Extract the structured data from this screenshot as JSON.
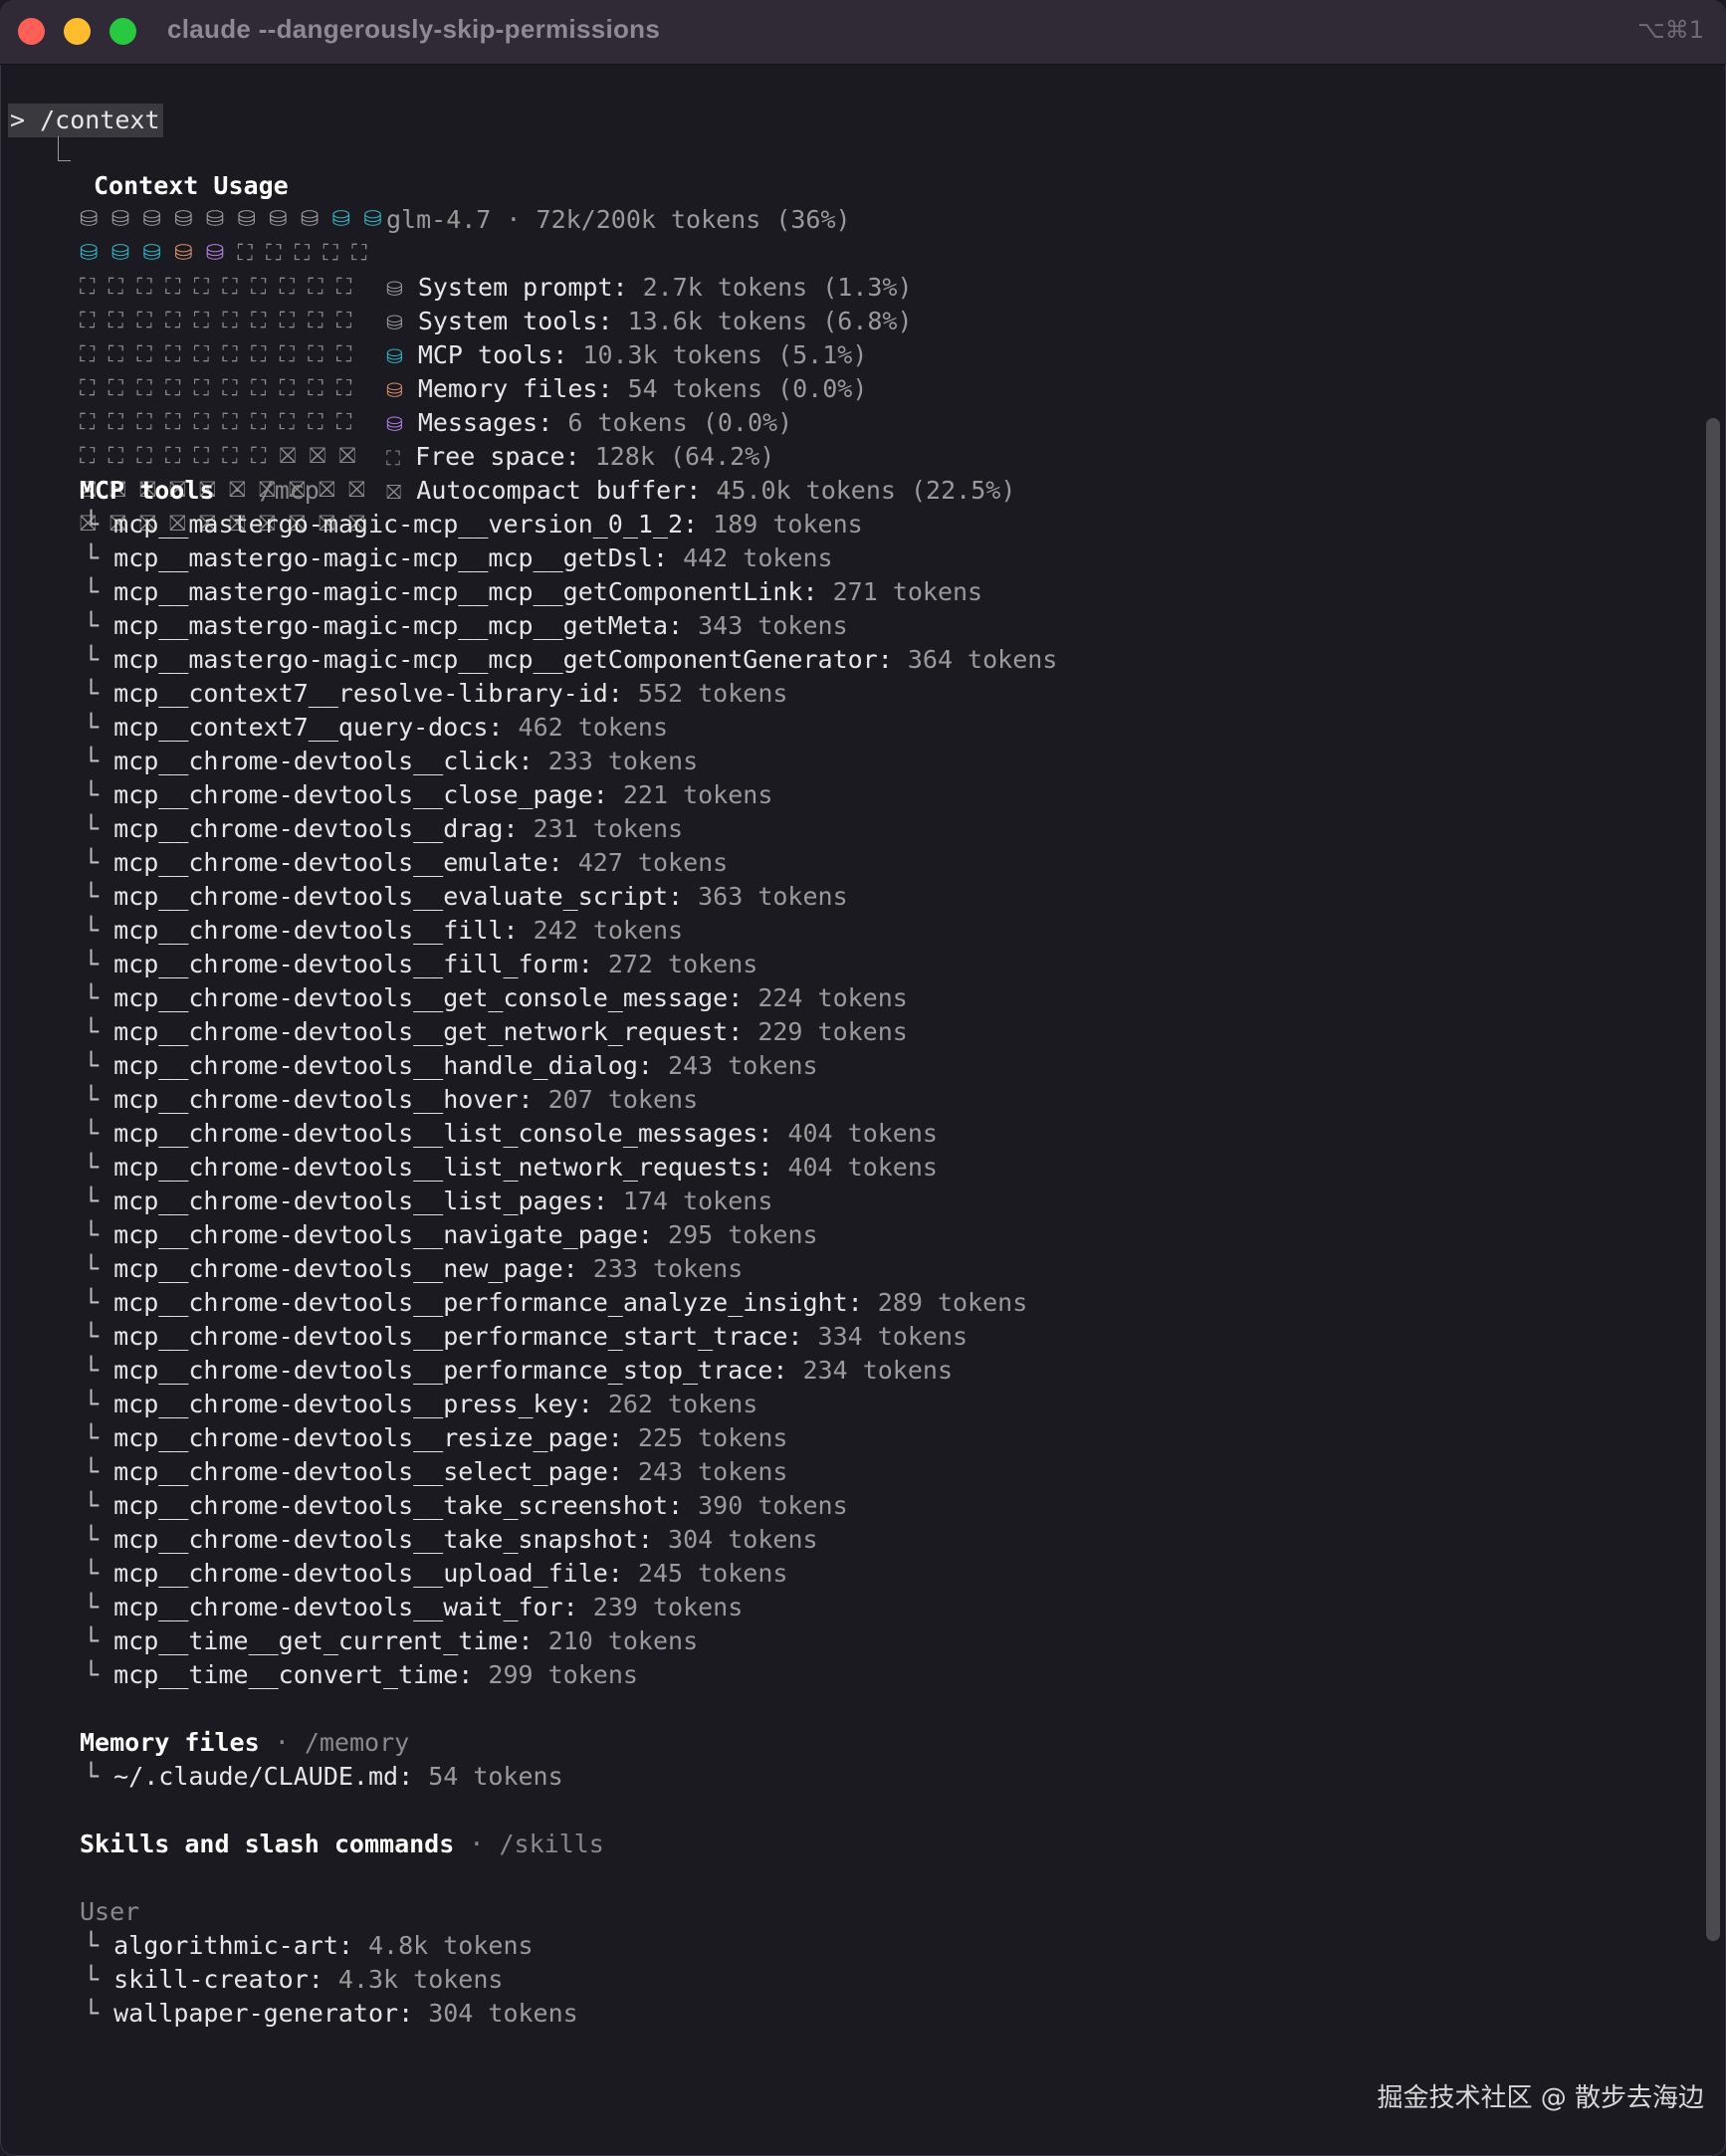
{
  "window": {
    "title": "claude --dangerously-skip-permissions",
    "shortcut": "⌥⌘1"
  },
  "prompt": {
    "symbol": ">",
    "command": "/context",
    "branch": "⎿"
  },
  "context": {
    "heading": "Context Usage",
    "summary": "glm-4.7 · 72k/200k tokens (36%)",
    "legend": [
      {
        "icon": "⛁",
        "label": "System prompt:",
        "value": "2.7k tokens (1.3%)",
        "color": "#9a9a9a"
      },
      {
        "icon": "⛁",
        "label": "System tools:",
        "value": "13.6k tokens (6.8%)",
        "color": "#9a9a9a"
      },
      {
        "icon": "⛁",
        "label": "MCP tools:",
        "value": "10.3k tokens (5.1%)",
        "color": "#2fb3c7"
      },
      {
        "icon": "⛁",
        "label": "Memory files:",
        "value": "54 tokens (0.0%)",
        "color": "#d98a6a"
      },
      {
        "icon": "⛁",
        "label": "Messages:",
        "value": "6 tokens (0.0%)",
        "color": "#b47de6"
      },
      {
        "icon": "⛶",
        "label": "Free space:",
        "value": "128k (64.2%)",
        "color": "#8a8a8a"
      },
      {
        "icon": "⛝",
        "label": "Autocompact buffer:",
        "value": "45.0k tokens (22.5%)",
        "color": "#8a8a8a"
      }
    ],
    "grid": [
      [
        "⛁",
        "⛁",
        "⛁",
        "⛁",
        "⛁",
        "⛁",
        "⛁",
        "⛁",
        "⛁",
        "⛁"
      ],
      [
        "⛁",
        "⛁",
        "⛁",
        "⛁",
        "⛁",
        "⛶",
        "⛶",
        "⛶",
        "⛶",
        "⛶"
      ],
      [
        "⛶",
        "⛶",
        "⛶",
        "⛶",
        "⛶",
        "⛶",
        "⛶",
        "⛶",
        "⛶",
        "⛶"
      ],
      [
        "⛶",
        "⛶",
        "⛶",
        "⛶",
        "⛶",
        "⛶",
        "⛶",
        "⛶",
        "⛶",
        "⛶"
      ],
      [
        "⛶",
        "⛶",
        "⛶",
        "⛶",
        "⛶",
        "⛶",
        "⛶",
        "⛶",
        "⛶",
        "⛶"
      ],
      [
        "⛶",
        "⛶",
        "⛶",
        "⛶",
        "⛶",
        "⛶",
        "⛶",
        "⛶",
        "⛶",
        "⛶"
      ],
      [
        "⛶",
        "⛶",
        "⛶",
        "⛶",
        "⛶",
        "⛶",
        "⛶",
        "⛶",
        "⛶",
        "⛶"
      ],
      [
        "⛶",
        "⛶",
        "⛶",
        "⛶",
        "⛶",
        "⛶",
        "⛶",
        "⛝",
        "⛝",
        "⛝"
      ],
      [
        "⛝",
        "⛝",
        "⛝",
        "⛝",
        "⛝",
        "⛝",
        "⛝",
        "⛝",
        "⛝",
        "⛝"
      ],
      [
        "⛝",
        "⛝",
        "⛝",
        "⛝",
        "⛝",
        "⛝",
        "⛝",
        "⛝",
        "⛝",
        "⛝"
      ]
    ],
    "grid_colors": [
      [
        "gray",
        "gray",
        "gray",
        "gray",
        "gray",
        "gray",
        "gray",
        "gray",
        "cyan",
        "cyan"
      ],
      [
        "cyan",
        "cyan",
        "cyan",
        "orange",
        "purple",
        "free",
        "free",
        "free",
        "free",
        "free"
      ],
      [
        "free",
        "free",
        "free",
        "free",
        "free",
        "free",
        "free",
        "free",
        "free",
        "free"
      ],
      [
        "free",
        "free",
        "free",
        "free",
        "free",
        "free",
        "free",
        "free",
        "free",
        "free"
      ],
      [
        "free",
        "free",
        "free",
        "free",
        "free",
        "free",
        "free",
        "free",
        "free",
        "free"
      ],
      [
        "free",
        "free",
        "free",
        "free",
        "free",
        "free",
        "free",
        "free",
        "free",
        "free"
      ],
      [
        "free",
        "free",
        "free",
        "free",
        "free",
        "free",
        "free",
        "free",
        "free",
        "free"
      ],
      [
        "free",
        "free",
        "free",
        "free",
        "free",
        "free",
        "free",
        "free",
        "free",
        "free"
      ],
      [
        "free",
        "free",
        "free",
        "free",
        "free",
        "free",
        "free",
        "free",
        "free",
        "free"
      ],
      [
        "free",
        "free",
        "free",
        "free",
        "free",
        "free",
        "free",
        "free",
        "free",
        "free"
      ]
    ]
  },
  "mcp": {
    "heading": "MCP tools",
    "sep": "·",
    "cmd": "/mcp",
    "items": [
      {
        "name": "mcp__mastergo-magic-mcp__version_0_1_2:",
        "tokens": "189 tokens"
      },
      {
        "name": "mcp__mastergo-magic-mcp__mcp__getDsl:",
        "tokens": "442 tokens"
      },
      {
        "name": "mcp__mastergo-magic-mcp__mcp__getComponentLink:",
        "tokens": "271 tokens"
      },
      {
        "name": "mcp__mastergo-magic-mcp__mcp__getMeta:",
        "tokens": "343 tokens"
      },
      {
        "name": "mcp__mastergo-magic-mcp__mcp__getComponentGenerator:",
        "tokens": "364 tokens"
      },
      {
        "name": "mcp__context7__resolve-library-id:",
        "tokens": "552 tokens"
      },
      {
        "name": "mcp__context7__query-docs:",
        "tokens": "462 tokens"
      },
      {
        "name": "mcp__chrome-devtools__click:",
        "tokens": "233 tokens"
      },
      {
        "name": "mcp__chrome-devtools__close_page:",
        "tokens": "221 tokens"
      },
      {
        "name": "mcp__chrome-devtools__drag:",
        "tokens": "231 tokens"
      },
      {
        "name": "mcp__chrome-devtools__emulate:",
        "tokens": "427 tokens"
      },
      {
        "name": "mcp__chrome-devtools__evaluate_script:",
        "tokens": "363 tokens"
      },
      {
        "name": "mcp__chrome-devtools__fill:",
        "tokens": "242 tokens"
      },
      {
        "name": "mcp__chrome-devtools__fill_form:",
        "tokens": "272 tokens"
      },
      {
        "name": "mcp__chrome-devtools__get_console_message:",
        "tokens": "224 tokens"
      },
      {
        "name": "mcp__chrome-devtools__get_network_request:",
        "tokens": "229 tokens"
      },
      {
        "name": "mcp__chrome-devtools__handle_dialog:",
        "tokens": "243 tokens"
      },
      {
        "name": "mcp__chrome-devtools__hover:",
        "tokens": "207 tokens"
      },
      {
        "name": "mcp__chrome-devtools__list_console_messages:",
        "tokens": "404 tokens"
      },
      {
        "name": "mcp__chrome-devtools__list_network_requests:",
        "tokens": "404 tokens"
      },
      {
        "name": "mcp__chrome-devtools__list_pages:",
        "tokens": "174 tokens"
      },
      {
        "name": "mcp__chrome-devtools__navigate_page:",
        "tokens": "295 tokens"
      },
      {
        "name": "mcp__chrome-devtools__new_page:",
        "tokens": "233 tokens"
      },
      {
        "name": "mcp__chrome-devtools__performance_analyze_insight:",
        "tokens": "289 tokens"
      },
      {
        "name": "mcp__chrome-devtools__performance_start_trace:",
        "tokens": "334 tokens"
      },
      {
        "name": "mcp__chrome-devtools__performance_stop_trace:",
        "tokens": "234 tokens"
      },
      {
        "name": "mcp__chrome-devtools__press_key:",
        "tokens": "262 tokens"
      },
      {
        "name": "mcp__chrome-devtools__resize_page:",
        "tokens": "225 tokens"
      },
      {
        "name": "mcp__chrome-devtools__select_page:",
        "tokens": "243 tokens"
      },
      {
        "name": "mcp__chrome-devtools__take_screenshot:",
        "tokens": "390 tokens"
      },
      {
        "name": "mcp__chrome-devtools__take_snapshot:",
        "tokens": "304 tokens"
      },
      {
        "name": "mcp__chrome-devtools__upload_file:",
        "tokens": "245 tokens"
      },
      {
        "name": "mcp__chrome-devtools__wait_for:",
        "tokens": "239 tokens"
      },
      {
        "name": "mcp__time__get_current_time:",
        "tokens": "210 tokens"
      },
      {
        "name": "mcp__time__convert_time:",
        "tokens": "299 tokens"
      }
    ]
  },
  "memory": {
    "heading": "Memory files",
    "sep": "·",
    "cmd": "/memory",
    "items": [
      {
        "name": "~/.claude/CLAUDE.md:",
        "tokens": "54 tokens"
      }
    ]
  },
  "skills": {
    "heading": "Skills and slash commands",
    "sep": "·",
    "cmd": "/skills",
    "group": "User",
    "items": [
      {
        "name": "algorithmic-art:",
        "tokens": "4.8k tokens"
      },
      {
        "name": "skill-creator:",
        "tokens": "4.3k tokens"
      },
      {
        "name": "wallpaper-generator:",
        "tokens": "304 tokens"
      }
    ]
  },
  "watermark": "掘金技术社区 @ 散步去海边"
}
